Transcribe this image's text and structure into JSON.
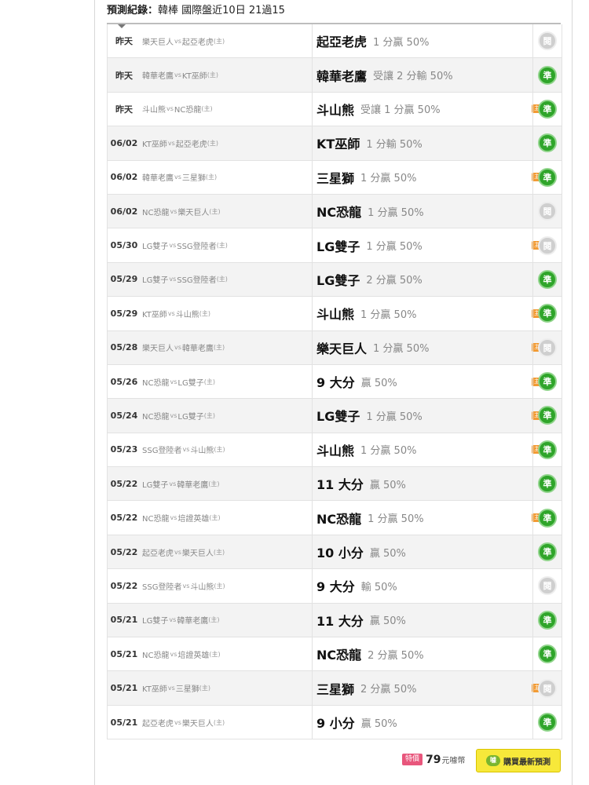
{
  "header": {
    "label": "預測紀錄：",
    "info": "韓棒 國際盤近10日 21過15"
  },
  "rows": [
    {
      "date": "昨天",
      "away": "樂天巨人",
      "vs": "vs",
      "home": "起亞老虎",
      "home_mark": "(主)",
      "team": "起亞老虎",
      "detail": "1 分贏 50%",
      "tag": "",
      "result": "閱",
      "win": false
    },
    {
      "date": "昨天",
      "away": "韓華老鷹",
      "vs": "vs",
      "home": "KT巫師",
      "home_mark": "(主)",
      "team": "韓華老鷹",
      "detail": "受讓 2 分輸 50%",
      "tag": "",
      "result": "準",
      "win": true
    },
    {
      "date": "昨天",
      "away": "斗山熊",
      "vs": "vs",
      "home": "NC恐龍",
      "home_mark": "(主)",
      "team": "斗山熊",
      "detail": "受讓 1 分贏 50%",
      "tag": "主推",
      "result": "準",
      "win": true
    },
    {
      "date": "06/02",
      "away": "KT巫師",
      "vs": "vs",
      "home": "起亞老虎",
      "home_mark": "(主)",
      "team": "KT巫師",
      "detail": "1 分輸 50%",
      "tag": "",
      "result": "準",
      "win": true
    },
    {
      "date": "06/02",
      "away": "韓華老鷹",
      "vs": "vs",
      "home": "三星獅",
      "home_mark": "(主)",
      "team": "三星獅",
      "detail": "1 分贏 50%",
      "tag": "主推",
      "result": "準",
      "win": true
    },
    {
      "date": "06/02",
      "away": "NC恐龍",
      "vs": "vs",
      "home": "樂天巨人",
      "home_mark": "(主)",
      "team": "NC恐龍",
      "detail": "1 分贏 50%",
      "tag": "",
      "result": "閱",
      "win": false
    },
    {
      "date": "05/30",
      "away": "LG雙子",
      "vs": "vs",
      "home": "SSG登陸者",
      "home_mark": "(主)",
      "team": "LG雙子",
      "detail": "1 分贏 50%",
      "tag": "主推",
      "result": "閱",
      "win": false
    },
    {
      "date": "05/29",
      "away": "LG雙子",
      "vs": "vs",
      "home": "SSG登陸者",
      "home_mark": "(主)",
      "team": "LG雙子",
      "detail": "2 分贏 50%",
      "tag": "",
      "result": "準",
      "win": true
    },
    {
      "date": "05/29",
      "away": "KT巫師",
      "vs": "vs",
      "home": "斗山熊",
      "home_mark": "(主)",
      "team": "斗山熊",
      "detail": "1 分贏 50%",
      "tag": "主推",
      "result": "準",
      "win": true
    },
    {
      "date": "05/28",
      "away": "樂天巨人",
      "vs": "vs",
      "home": "韓華老鷹",
      "home_mark": "(主)",
      "team": "樂天巨人",
      "detail": "1 分贏 50%",
      "tag": "主推",
      "result": "閱",
      "win": false
    },
    {
      "date": "05/26",
      "away": "NC恐龍",
      "vs": "vs",
      "home": "LG雙子",
      "home_mark": "(主)",
      "team": "9 大分",
      "detail": "贏 50%",
      "tag": "主推",
      "result": "準",
      "win": true
    },
    {
      "date": "05/24",
      "away": "NC恐龍",
      "vs": "vs",
      "home": "LG雙子",
      "home_mark": "(主)",
      "team": "LG雙子",
      "detail": "1 分贏 50%",
      "tag": "主推",
      "result": "準",
      "win": true
    },
    {
      "date": "05/23",
      "away": "SSG登陸者",
      "vs": "vs",
      "home": "斗山熊",
      "home_mark": "(主)",
      "team": "斗山熊",
      "detail": "1 分贏 50%",
      "tag": "主推",
      "result": "準",
      "win": true
    },
    {
      "date": "05/22",
      "away": "LG雙子",
      "vs": "vs",
      "home": "韓華老鷹",
      "home_mark": "(主)",
      "team": "11 大分",
      "detail": "贏 50%",
      "tag": "",
      "result": "準",
      "win": true
    },
    {
      "date": "05/22",
      "away": "NC恐龍",
      "vs": "vs",
      "home": "培證英雄",
      "home_mark": "(主)",
      "team": "NC恐龍",
      "detail": "1 分贏 50%",
      "tag": "主推",
      "result": "準",
      "win": true
    },
    {
      "date": "05/22",
      "away": "起亞老虎",
      "vs": "vs",
      "home": "樂天巨人",
      "home_mark": "(主)",
      "team": "10 小分",
      "detail": "贏 50%",
      "tag": "",
      "result": "準",
      "win": true
    },
    {
      "date": "05/22",
      "away": "SSG登陸者",
      "vs": "vs",
      "home": "斗山熊",
      "home_mark": "(主)",
      "team": "9 大分",
      "detail": "輸 50%",
      "tag": "",
      "result": "閱",
      "win": false
    },
    {
      "date": "05/21",
      "away": "LG雙子",
      "vs": "vs",
      "home": "韓華老鷹",
      "home_mark": "(主)",
      "team": "11 大分",
      "detail": "贏 50%",
      "tag": "",
      "result": "準",
      "win": true
    },
    {
      "date": "05/21",
      "away": "NC恐龍",
      "vs": "vs",
      "home": "培證英雄",
      "home_mark": "(主)",
      "team": "NC恐龍",
      "detail": "2 分贏 50%",
      "tag": "",
      "result": "準",
      "win": true
    },
    {
      "date": "05/21",
      "away": "KT巫師",
      "vs": "vs",
      "home": "三星獅",
      "home_mark": "(主)",
      "team": "三星獅",
      "detail": "2 分贏 50%",
      "tag": "主推",
      "result": "閱",
      "win": false
    },
    {
      "date": "05/21",
      "away": "起亞老虎",
      "vs": "vs",
      "home": "樂天巨人",
      "home_mark": "(主)",
      "team": "9 小分",
      "detail": "贏 50%",
      "tag": "",
      "result": "準",
      "win": true
    }
  ],
  "footer": {
    "special_label": "特價",
    "price": "79",
    "unit": "元噱幣",
    "buy_icon": "噱",
    "buy_label": "購買最新預測"
  },
  "colors": {
    "win_badge": "#2fa52a",
    "lose_badge": "#cfcfcf",
    "tag": "#f29b34",
    "buy_button": "#f7e83a",
    "special_badge": "#e8567c"
  }
}
